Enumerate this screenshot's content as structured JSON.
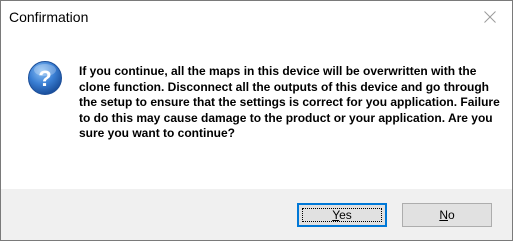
{
  "dialog": {
    "title": "Confirmation",
    "icon": "question-icon",
    "message": "If you continue, all the maps in this device will be overwritten with the clone function. Disconnect all the outputs of this device and go through the setup to ensure that the settings is correct for you application. Failure to do this may cause damage to the product or your application. Are you sure you want to continue?",
    "buttons": {
      "yes": {
        "mnemonic": "Y",
        "rest": "es",
        "is_default": true
      },
      "no": {
        "mnemonic": "N",
        "rest": "o",
        "is_default": false
      }
    },
    "close_icon": "close-icon"
  },
  "colors": {
    "accent": "#0078d7",
    "icon_blue": "#2b6cc4",
    "button_bar": "#f0f0f0"
  }
}
